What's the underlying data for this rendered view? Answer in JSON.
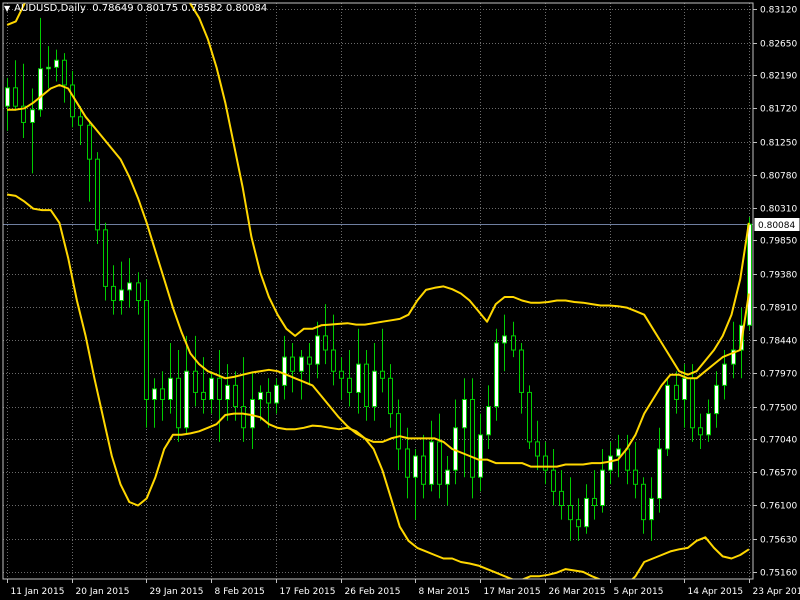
{
  "header": {
    "symbol_label": "AUDUSD,Daily",
    "ohlc_text": "0.78649 0.80175 0.78582 0.80084"
  },
  "colors": {
    "background": "#000000",
    "grid": "#6b6b6b",
    "bull_candle": "#ffffff",
    "bear_candle": "#000000",
    "candle_outline": "#00cc00",
    "band": "#ffd700",
    "price_line": "#6f7fa0",
    "text": "#ffffff"
  },
  "chart_data": {
    "type": "candlestick",
    "title": "AUDUSD,Daily",
    "ylim": [
      0.7506,
      0.8321
    ],
    "y_ticks": [
      "0.83120",
      "0.82650",
      "0.82190",
      "0.81720",
      "0.81250",
      "0.80780",
      "0.80310",
      "0.79850",
      "0.79380",
      "0.78910",
      "0.78440",
      "0.77970",
      "0.77500",
      "0.77040",
      "0.76570",
      "0.76100",
      "0.75630",
      "0.75160"
    ],
    "x_ticks": [
      "11 Jan 2015",
      "20 Jan 2015",
      "29 Jan 2015",
      "8 Feb 2015",
      "17 Feb 2015",
      "26 Feb 2015",
      "8 Mar 2015",
      "17 Mar 2015",
      "26 Mar 2015",
      "5 Apr 2015",
      "14 Apr 2015",
      "23 Apr 2015"
    ],
    "current_price": "0.80084",
    "grid": true,
    "candles_ohlc": [
      [
        0.8175,
        0.8215,
        0.814,
        0.8201
      ],
      [
        0.8201,
        0.824,
        0.817,
        0.8175
      ],
      [
        0.8175,
        0.8235,
        0.813,
        0.8152
      ],
      [
        0.8152,
        0.82,
        0.808,
        0.817
      ],
      [
        0.817,
        0.83,
        0.816,
        0.8228
      ],
      [
        0.8228,
        0.826,
        0.82,
        0.823
      ],
      [
        0.823,
        0.8255,
        0.821,
        0.824
      ],
      [
        0.824,
        0.825,
        0.818,
        0.8205
      ],
      [
        0.8205,
        0.8225,
        0.8145,
        0.816
      ],
      [
        0.816,
        0.8175,
        0.812,
        0.8148
      ],
      [
        0.8148,
        0.8155,
        0.804,
        0.81
      ],
      [
        0.81,
        0.811,
        0.798,
        0.8
      ],
      [
        0.8,
        0.801,
        0.79,
        0.792
      ],
      [
        0.792,
        0.795,
        0.788,
        0.79
      ],
      [
        0.79,
        0.7955,
        0.788,
        0.7915
      ],
      [
        0.7915,
        0.796,
        0.789,
        0.7925
      ],
      [
        0.7925,
        0.794,
        0.788,
        0.79
      ],
      [
        0.79,
        0.793,
        0.772,
        0.776
      ],
      [
        0.776,
        0.779,
        0.772,
        0.7775
      ],
      [
        0.7775,
        0.78,
        0.773,
        0.776
      ],
      [
        0.776,
        0.784,
        0.774,
        0.779
      ],
      [
        0.779,
        0.783,
        0.77,
        0.772
      ],
      [
        0.772,
        0.785,
        0.771,
        0.78
      ],
      [
        0.78,
        0.785,
        0.775,
        0.777
      ],
      [
        0.777,
        0.782,
        0.774,
        0.776
      ],
      [
        0.776,
        0.78,
        0.774,
        0.779
      ],
      [
        0.779,
        0.783,
        0.77,
        0.776
      ],
      [
        0.776,
        0.781,
        0.773,
        0.778
      ],
      [
        0.778,
        0.78,
        0.773,
        0.775
      ],
      [
        0.775,
        0.782,
        0.77,
        0.772
      ],
      [
        0.772,
        0.78,
        0.769,
        0.776
      ],
      [
        0.776,
        0.778,
        0.773,
        0.777
      ],
      [
        0.777,
        0.779,
        0.772,
        0.7755
      ],
      [
        0.7755,
        0.779,
        0.774,
        0.778
      ],
      [
        0.778,
        0.785,
        0.776,
        0.782
      ],
      [
        0.782,
        0.784,
        0.777,
        0.78
      ],
      [
        0.78,
        0.783,
        0.776,
        0.782
      ],
      [
        0.782,
        0.784,
        0.778,
        0.781
      ],
      [
        0.781,
        0.787,
        0.779,
        0.785
      ],
      [
        0.785,
        0.7895,
        0.781,
        0.783
      ],
      [
        0.783,
        0.788,
        0.778,
        0.78
      ],
      [
        0.78,
        0.782,
        0.776,
        0.779
      ],
      [
        0.779,
        0.783,
        0.775,
        0.777
      ],
      [
        0.777,
        0.786,
        0.774,
        0.781
      ],
      [
        0.781,
        0.783,
        0.773,
        0.775
      ],
      [
        0.775,
        0.784,
        0.773,
        0.78
      ],
      [
        0.78,
        0.786,
        0.777,
        0.779
      ],
      [
        0.779,
        0.781,
        0.772,
        0.774
      ],
      [
        0.774,
        0.776,
        0.766,
        0.769
      ],
      [
        0.769,
        0.772,
        0.762,
        0.765
      ],
      [
        0.765,
        0.769,
        0.759,
        0.768
      ],
      [
        0.768,
        0.771,
        0.762,
        0.764
      ],
      [
        0.764,
        0.773,
        0.763,
        0.77
      ],
      [
        0.77,
        0.774,
        0.762,
        0.764
      ],
      [
        0.764,
        0.768,
        0.761,
        0.766
      ],
      [
        0.766,
        0.776,
        0.764,
        0.772
      ],
      [
        0.772,
        0.779,
        0.765,
        0.776
      ],
      [
        0.776,
        0.779,
        0.762,
        0.765
      ],
      [
        0.765,
        0.774,
        0.763,
        0.771
      ],
      [
        0.771,
        0.778,
        0.769,
        0.775
      ],
      [
        0.775,
        0.786,
        0.773,
        0.784
      ],
      [
        0.784,
        0.788,
        0.78,
        0.785
      ],
      [
        0.785,
        0.787,
        0.782,
        0.783
      ],
      [
        0.783,
        0.784,
        0.774,
        0.777
      ],
      [
        0.777,
        0.778,
        0.769,
        0.77
      ],
      [
        0.77,
        0.773,
        0.766,
        0.768
      ],
      [
        0.768,
        0.77,
        0.764,
        0.766
      ],
      [
        0.766,
        0.769,
        0.761,
        0.763
      ],
      [
        0.763,
        0.766,
        0.759,
        0.761
      ],
      [
        0.761,
        0.765,
        0.756,
        0.759
      ],
      [
        0.759,
        0.762,
        0.756,
        0.758
      ],
      [
        0.758,
        0.764,
        0.757,
        0.762
      ],
      [
        0.762,
        0.766,
        0.759,
        0.761
      ],
      [
        0.761,
        0.769,
        0.76,
        0.766
      ],
      [
        0.766,
        0.77,
        0.764,
        0.768
      ],
      [
        0.768,
        0.771,
        0.765,
        0.769
      ],
      [
        0.769,
        0.771,
        0.764,
        0.766
      ],
      [
        0.766,
        0.77,
        0.762,
        0.764
      ],
      [
        0.764,
        0.765,
        0.757,
        0.759
      ],
      [
        0.759,
        0.765,
        0.756,
        0.762
      ],
      [
        0.762,
        0.772,
        0.76,
        0.769
      ],
      [
        0.769,
        0.779,
        0.768,
        0.778
      ],
      [
        0.778,
        0.78,
        0.774,
        0.776
      ],
      [
        0.776,
        0.781,
        0.772,
        0.779
      ],
      [
        0.779,
        0.781,
        0.77,
        0.772
      ],
      [
        0.772,
        0.774,
        0.769,
        0.771
      ],
      [
        0.771,
        0.776,
        0.77,
        0.774
      ],
      [
        0.774,
        0.78,
        0.772,
        0.778
      ],
      [
        0.778,
        0.783,
        0.776,
        0.781
      ],
      [
        0.781,
        0.787,
        0.779,
        0.783
      ],
      [
        0.783,
        0.789,
        0.779,
        0.7865
      ],
      [
        0.7865,
        0.8018,
        0.7858,
        0.8008
      ]
    ],
    "series": [
      {
        "values": [
          0.829,
          0.8295,
          0.832,
          0.8342,
          0.8355,
          0.8355,
          0.8355,
          0.837,
          0.8395,
          0.842,
          0.844,
          0.8455,
          0.8465,
          0.8465,
          0.846,
          0.845,
          0.843,
          0.84,
          0.837,
          0.835,
          0.834,
          0.832,
          0.83,
          0.827,
          0.823,
          0.818,
          0.812,
          0.806,
          0.799,
          0.794,
          0.7905,
          0.788,
          0.786,
          0.785,
          0.786,
          0.786,
          0.7865,
          0.7866,
          0.7867,
          0.7868,
          0.7866,
          0.7866,
          0.7868,
          0.787,
          0.7872,
          0.7874,
          0.788,
          0.79,
          0.7915,
          0.7918,
          0.792,
          0.7916,
          0.791,
          0.79,
          0.7885,
          0.787,
          0.7895,
          0.7905,
          0.7905,
          0.79,
          0.7897,
          0.7897,
          0.7898,
          0.79,
          0.79,
          0.7898,
          0.7897,
          0.7895,
          0.7893,
          0.7893,
          0.7892,
          0.789,
          0.7885,
          0.788,
          0.786,
          0.784,
          0.782,
          0.78,
          0.7795,
          0.78,
          0.7815,
          0.783,
          0.785,
          0.788,
          0.793,
          0.801
        ]
      },
      {
        "values": [
          0.817,
          0.817,
          0.8172,
          0.818,
          0.819,
          0.82,
          0.8205,
          0.82,
          0.818,
          0.816,
          0.8145,
          0.813,
          0.8115,
          0.81,
          0.8075,
          0.8045,
          0.801,
          0.797,
          0.793,
          0.789,
          0.7855,
          0.7825,
          0.781,
          0.78,
          0.7795,
          0.779,
          0.7792,
          0.7795,
          0.7798,
          0.78,
          0.7802,
          0.78,
          0.7795,
          0.779,
          0.7785,
          0.778,
          0.7765,
          0.775,
          0.7735,
          0.7722,
          0.7712,
          0.7705,
          0.77,
          0.77,
          0.7705,
          0.7708,
          0.7705,
          0.7705,
          0.7705,
          0.7705,
          0.77,
          0.769,
          0.7685,
          0.768,
          0.7675,
          0.7675,
          0.767,
          0.767,
          0.767,
          0.767,
          0.7665,
          0.7665,
          0.7665,
          0.7665,
          0.7668,
          0.7668,
          0.7668,
          0.767,
          0.767,
          0.7672,
          0.7675,
          0.769,
          0.771,
          0.774,
          0.776,
          0.778,
          0.7795,
          0.7795,
          0.779,
          0.779,
          0.78,
          0.781,
          0.782,
          0.7825,
          0.783,
          0.791
        ]
      },
      {
        "values": [
          0.805,
          0.8048,
          0.804,
          0.803,
          0.8028,
          0.8028,
          0.801,
          0.796,
          0.79,
          0.785,
          0.779,
          0.7735,
          0.768,
          0.764,
          0.7615,
          0.761,
          0.762,
          0.765,
          0.769,
          0.771,
          0.771,
          0.7712,
          0.7715,
          0.772,
          0.7725,
          0.7738,
          0.774,
          0.774,
          0.7738,
          0.7735,
          0.7725,
          0.772,
          0.7718,
          0.7718,
          0.772,
          0.7723,
          0.7722,
          0.772,
          0.7718,
          0.772,
          0.7715,
          0.7705,
          0.769,
          0.766,
          0.762,
          0.758,
          0.756,
          0.755,
          0.7545,
          0.754,
          0.7535,
          0.7535,
          0.753,
          0.7528,
          0.7525,
          0.752,
          0.7515,
          0.751,
          0.7505,
          0.7505,
          0.751,
          0.751,
          0.7512,
          0.7515,
          0.752,
          0.7518,
          0.7516,
          0.751,
          0.7505,
          0.75,
          0.7495,
          0.7498,
          0.751,
          0.753,
          0.7535,
          0.754,
          0.7545,
          0.7548,
          0.755,
          0.756,
          0.7565,
          0.755,
          0.7538,
          0.7535,
          0.754,
          0.7548
        ]
      }
    ]
  }
}
